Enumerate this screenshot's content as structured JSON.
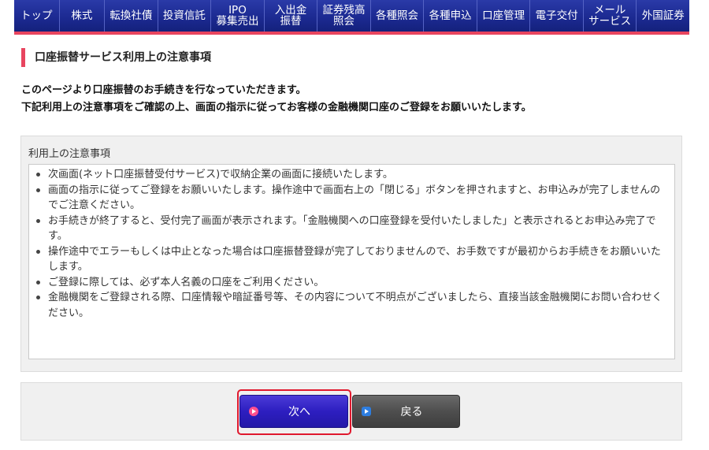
{
  "nav": {
    "items": [
      {
        "label": "トップ"
      },
      {
        "label": "株式"
      },
      {
        "label": "転換社債"
      },
      {
        "label": "投資信託"
      },
      {
        "label": "IPO\n募集売出"
      },
      {
        "label": "入出金\n振替"
      },
      {
        "label": "証券残高\n照会"
      },
      {
        "label": "各種照会"
      },
      {
        "label": "各種申込"
      },
      {
        "label": "口座管理"
      },
      {
        "label": "電子交付"
      },
      {
        "label": "メール\nサービス"
      },
      {
        "label": "外国証券"
      }
    ]
  },
  "page": {
    "heading": "口座振替サービス利用上の注意事項",
    "intro_line1": "このページより口座振替のお手続きを行なっていただきます。",
    "intro_line2": "下記利用上の注意事項をご確認の上、画面の指示に従ってお客様の金融機関口座のご登録をお願いいたします。"
  },
  "notes": {
    "title": "利用上の注意事項",
    "items": [
      "次画面(ネット口座振替受付サービス)で収納企業の画面に接続いたします。",
      "画面の指示に従ってご登録をお願いいたします。操作途中で画面右上の「閉じる」ボタンを押されますと、お申込みが完了しませんのでご注意ください。",
      "お手続きが終了すると、受付完了画面が表示されます。「金融機関への口座登録を受付いたしました」と表示されるとお申込み完了です。",
      "操作途中でエラーもしくは中止となった場合は口座振替登録が完了しておりませんので、お手数ですが最初からお手続きをお願いいたします。",
      "ご登録に際しては、必ず本人名義の口座をご利用ください。",
      "金融機関をご登録される際、口座情報や暗証番号等、その内容について不明点がございましたら、直接当該金融機関にお問い合わせください。"
    ]
  },
  "buttons": {
    "next_label": "次へ",
    "back_label": "戻る",
    "next_icon": "play-circle-icon",
    "back_icon": "arrow-right-square-icon"
  },
  "colors": {
    "nav_bg": "#1c2a92",
    "accent_pink": "#e8455f",
    "next_button": "#2d1ec0",
    "back_button": "#4e4e4e",
    "highlight": "#e0192e"
  }
}
